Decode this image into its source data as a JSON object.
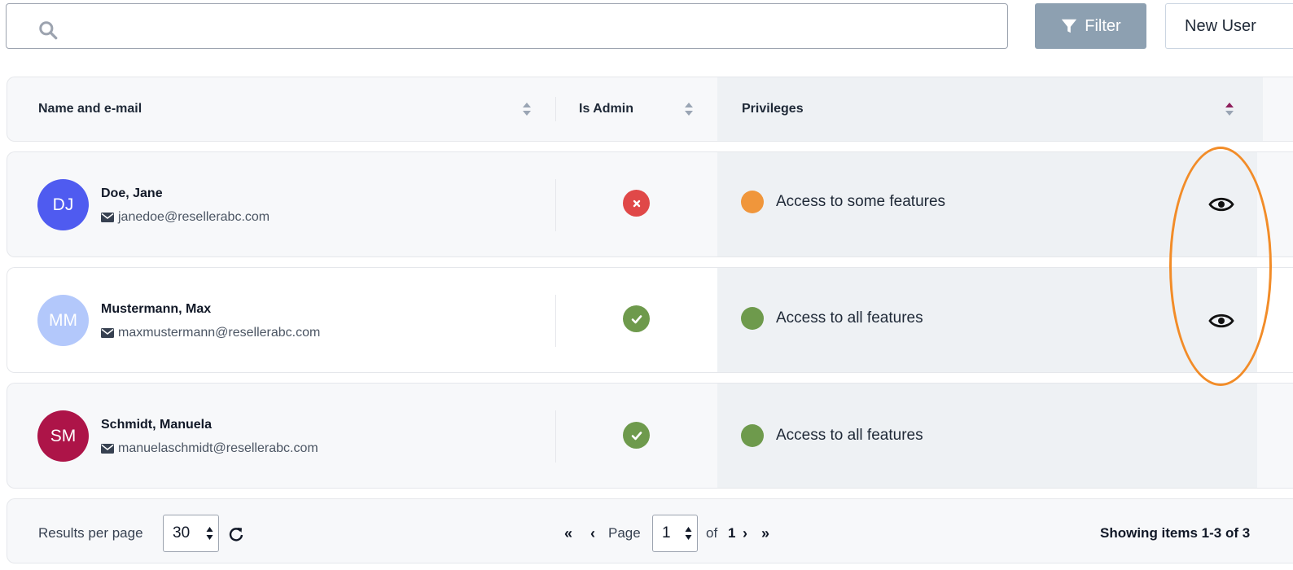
{
  "toolbar": {
    "filter_label": "Filter",
    "new_user_label": "New User"
  },
  "table": {
    "columns": {
      "name": "Name and e-mail",
      "admin": "Is Admin",
      "privileges": "Privileges"
    },
    "rows": [
      {
        "initials": "DJ",
        "avatar_color": "#4f5bf0",
        "name": "Doe, Jane",
        "email": "janedoe@resellerabc.com",
        "is_admin": false,
        "privilege": "Access to some features",
        "privilege_color": "#f0963b"
      },
      {
        "initials": "MM",
        "avatar_color": "#b3c8fb",
        "name": "Mustermann, Max",
        "email": "maxmustermann@resellerabc.com",
        "is_admin": true,
        "privilege": "Access to all features",
        "privilege_color": "#6e9a4c"
      },
      {
        "initials": "SM",
        "avatar_color": "#ad1448",
        "name": "Schmidt, Manuela",
        "email": "manuelaschmidt@resellerabc.com",
        "is_admin": true,
        "privilege": "Access to all features",
        "privilege_color": "#6e9a4c"
      }
    ]
  },
  "footer": {
    "results_per_page_label": "Results per page",
    "results_per_page_value": "30",
    "page_label": "Page",
    "page_value": "1",
    "of_label": "of",
    "total_pages": "1",
    "showing_label": "Showing items 1-3 of 3"
  },
  "colors": {
    "admin_yes": "#6e9a4c",
    "admin_no": "#e04848",
    "highlight": "#f28c28"
  }
}
